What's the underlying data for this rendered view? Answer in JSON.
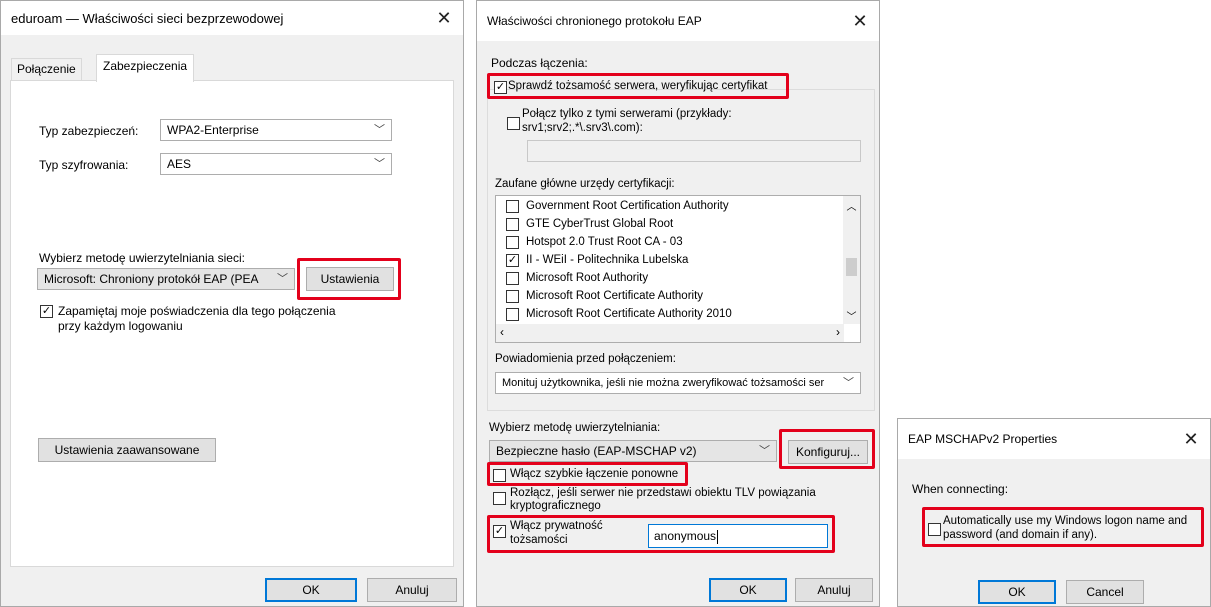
{
  "dialog1": {
    "title": "eduroam — Właściwości sieci bezprzewodowej",
    "tabs": [
      "Połączenie",
      "Zabezpieczenia"
    ],
    "security_type_label": "Typ zabezpieczeń:",
    "security_type_value": "WPA2-Enterprise",
    "encryption_type_label": "Typ szyfrowania:",
    "encryption_type_value": "AES",
    "auth_method_label": "Wybierz metodę uwierzytelniania sieci:",
    "auth_method_value": "Microsoft: Chroniony protokół EAP (PEA",
    "settings_button": "Ustawienia",
    "remember_line1": "Zapamiętaj moje poświadczenia dla tego połączenia",
    "remember_line2": "przy każdym logowaniu",
    "advanced_button": "Ustawienia zaawansowane",
    "ok": "OK",
    "cancel": "Anuluj"
  },
  "dialog2": {
    "title": "Właściwości chronionego protokołu EAP",
    "when_connecting": "Podczas łączenia:",
    "verify_server": "Sprawdź tożsamość serwera, weryfikując certyfikat",
    "connect_servers_line1": "Połącz tylko z tymi serwerami (przykłady:",
    "connect_servers_line2": "srv1;srv2;.*\\.srv3\\.com):",
    "trusted_ca_label": "Zaufane główne urzędy certyfikacji:",
    "ca_list": [
      {
        "name": "Government Root Certification Authority",
        "checked": false
      },
      {
        "name": "GTE CyberTrust Global Root",
        "checked": false
      },
      {
        "name": "Hotspot 2.0 Trust Root CA - 03",
        "checked": false
      },
      {
        "name": "II - WEiI - Politechnika Lubelska",
        "checked": true
      },
      {
        "name": "Microsoft Root Authority",
        "checked": false
      },
      {
        "name": "Microsoft Root Certificate Authority",
        "checked": false
      },
      {
        "name": "Microsoft Root Certificate Authority 2010",
        "checked": false
      }
    ],
    "notifications_label": "Powiadomienia przed połączeniem:",
    "notifications_value": "Monituj użytkownika, jeśli nie można zweryfikować tożsamości ser",
    "auth_method_label": "Wybierz metodę uwierzytelniania:",
    "auth_method_value": "Bezpieczne hasło (EAP-MSCHAP v2)",
    "configure_button": "Konfiguruj...",
    "fast_reconnect": "Włącz szybkie łączenie ponowne",
    "disconnect_line1": "Rozłącz, jeśli serwer nie przedstawi obiektu TLV powiązania",
    "disconnect_line2": "kryptograficznego",
    "privacy_line1": "Włącz prywatność",
    "privacy_line2": "tożsamości",
    "identity_value": "anonymous",
    "ok": "OK",
    "cancel": "Anuluj"
  },
  "dialog3": {
    "title": "EAP MSCHAPv2 Properties",
    "when_connecting": "When connecting:",
    "auto_logon_line1": "Automatically use my Windows logon name and",
    "auto_logon_line2": "password (and domain if any).",
    "ok": "OK",
    "cancel": "Cancel"
  },
  "colors": {
    "highlight": "#e3001b",
    "accent": "#0078d7"
  },
  "icons": {
    "close": "close-icon",
    "chevron": "chevron-down-icon",
    "check": "check-icon"
  }
}
